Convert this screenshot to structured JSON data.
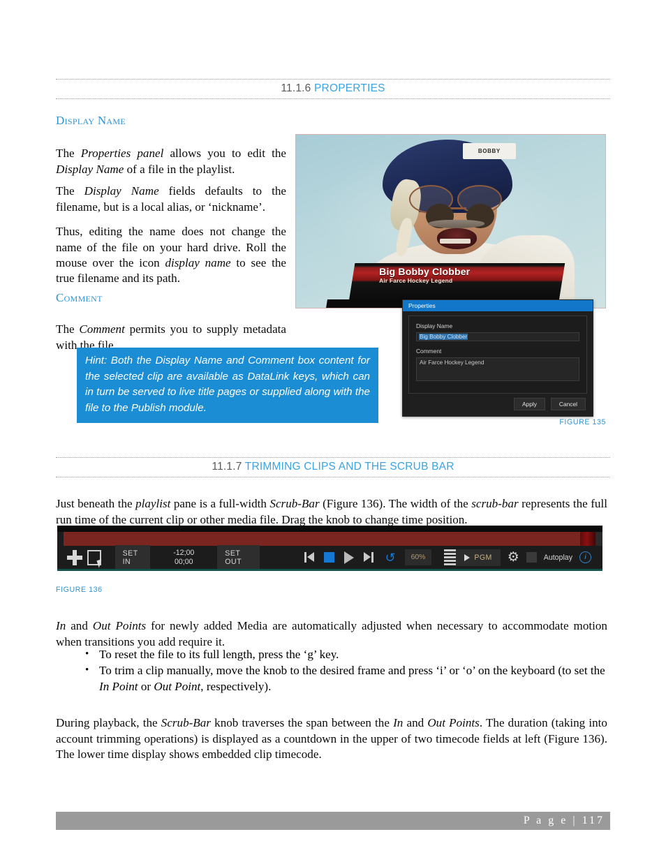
{
  "sections": {
    "properties": {
      "number": "11.1.6",
      "title": "PROPERTIES"
    },
    "trimming": {
      "number": "11.1.7",
      "title": "TRIMMING CLIPS AND THE SCRUB BAR"
    }
  },
  "subheads": {
    "display_name": "Display Name",
    "comment": "Comment"
  },
  "paragraphs": {
    "p1_a": "The ",
    "p1_b": "Properties panel",
    "p1_c": " allows you to edit the ",
    "p1_d": "Display Name",
    "p1_e": " of a file in the playlist.",
    "p2_a": "The ",
    "p2_b": "Display Name",
    "p2_c": " fields defaults to the filename, but is a local alias, or ‘nickname’.",
    "p3_a": "Thus, editing the name does not change the name of the file on your hard drive.  Roll the mouse over the icon ",
    "p3_b": "display name",
    "p3_c": " to see the true filename and its path.",
    "p4_a": "The ",
    "p4_b": "Comment",
    "p4_c": " permits you to supply metadata with the file.",
    "scrub_a": "Just beneath the ",
    "scrub_b": "playlist",
    "scrub_c": " pane is a full-width ",
    "scrub_d": "Scrub-Bar",
    "scrub_e": " (Figure 136).  The width of the ",
    "scrub_f": "scrub-bar",
    "scrub_g": " represents the full run time of the current clip or other media file.   Drag the knob to change time position.",
    "inout_a": "In",
    "inout_b": " and ",
    "inout_c": "Out Points",
    "inout_d": " for newly added Media are automatically adjusted when necessary to accommodate motion when transitions you add require it.",
    "during_a": "During playback, the ",
    "during_b": "Scrub-Bar",
    "during_c": " knob traverses the span between the ",
    "during_d": "In",
    "during_e": " and ",
    "during_f": "Out Points",
    "during_g": ".  The duration (taking into account trimming operations) is displayed as a countdown in the upper of two timecode fields at left (Figure 136). The lower time display shows embedded clip timecode."
  },
  "hint": {
    "text": "Hint: Both the Display Name and Comment box content for the selected clip are available as DataLink keys, which can in turn be served to live title pages or supplied along with the file to the Publish module."
  },
  "bullets": [
    {
      "a": "To reset the file to its full length, press the ‘g’ key.",
      "b": "",
      "c": "",
      "d": "",
      "e": ""
    },
    {
      "a": "To trim a clip manually, move the knob to the desired frame and press ‘i’ or ‘o’ on the keyboard (to set the ",
      "b": "In Point",
      "c": " or ",
      "d": "Out Point",
      "e": ", respectively)."
    }
  ],
  "figure135": {
    "caption": "FIGURE 135",
    "photo": {
      "helmet_label": "BOBBY",
      "lower_third_title": "Big Bobby Clobber",
      "lower_third_subtitle": "Air Farce Hockey Legend"
    },
    "dialog": {
      "title": "Properties",
      "display_name_label": "Display Name",
      "display_name_value": "Big Bobby Clobber",
      "comment_label": "Comment",
      "comment_value": "Air Farce Hockey Legend",
      "apply_label": "Apply",
      "cancel_label": "Cancel"
    }
  },
  "figure136": {
    "caption": "FIGURE 136",
    "toolbar": {
      "set_in_label": "SET IN",
      "set_out_label": "SET OUT",
      "timecode_top": "-12;00",
      "timecode_bottom": "00;00",
      "speed_label": "60%",
      "pgm_label": "PGM",
      "autoplay_label": "Autoplay",
      "info_glyph": "i",
      "loop_glyph": "↺"
    }
  },
  "footer": {
    "text": "P a g e | 117"
  },
  "colors": {
    "accent_blue": "#2f93d4",
    "heading_blue": "#3aa3e3",
    "hint_bg": "#1b8dd4",
    "dialog_title_bg": "#1277c8",
    "scrub_track": "#7b2520",
    "footer_bg": "#9a9a9a"
  }
}
